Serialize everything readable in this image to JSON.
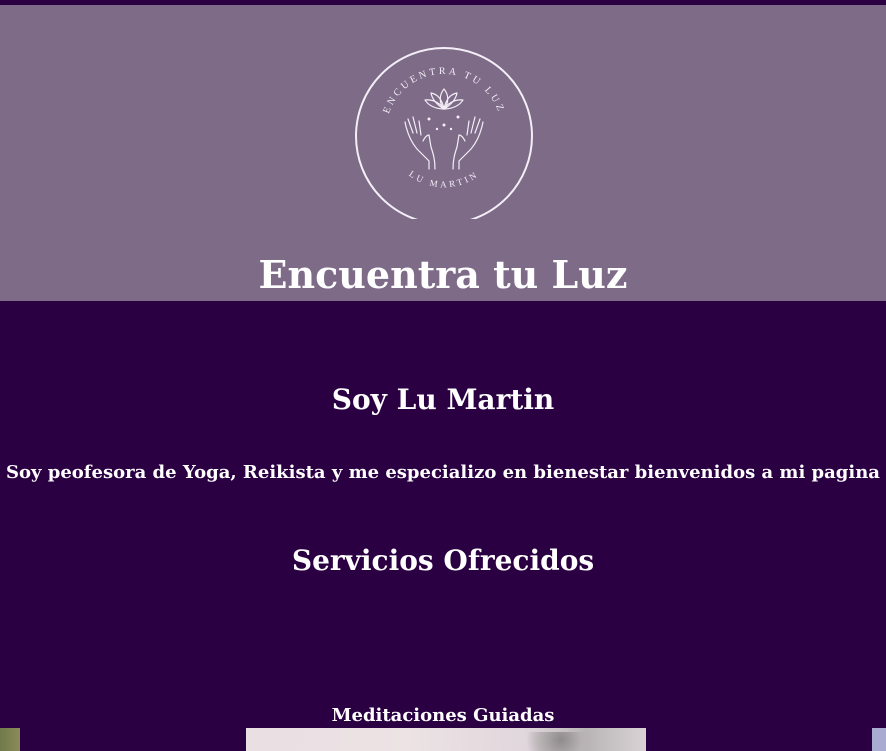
{
  "header": {
    "logo": {
      "arc_text_top": "ENCUENTRA TU LUZ",
      "arc_text_bottom": "LU MARTIN",
      "icon": "lotus-hands-icon"
    },
    "title": "Encuentra tu Luz"
  },
  "about": {
    "title": "Soy Lu Martin",
    "text": "Soy peofesora de Yoga, Reikista y me especializo en bienestar bienvenidos a mi pagina"
  },
  "services": {
    "title": "Servicios Ofrecidos",
    "items": [
      {
        "name": "Meditaciones Guiadas"
      }
    ]
  },
  "colors": {
    "background": "#2b0043",
    "header_background": "#7d6b88",
    "text": "#ffffff"
  }
}
